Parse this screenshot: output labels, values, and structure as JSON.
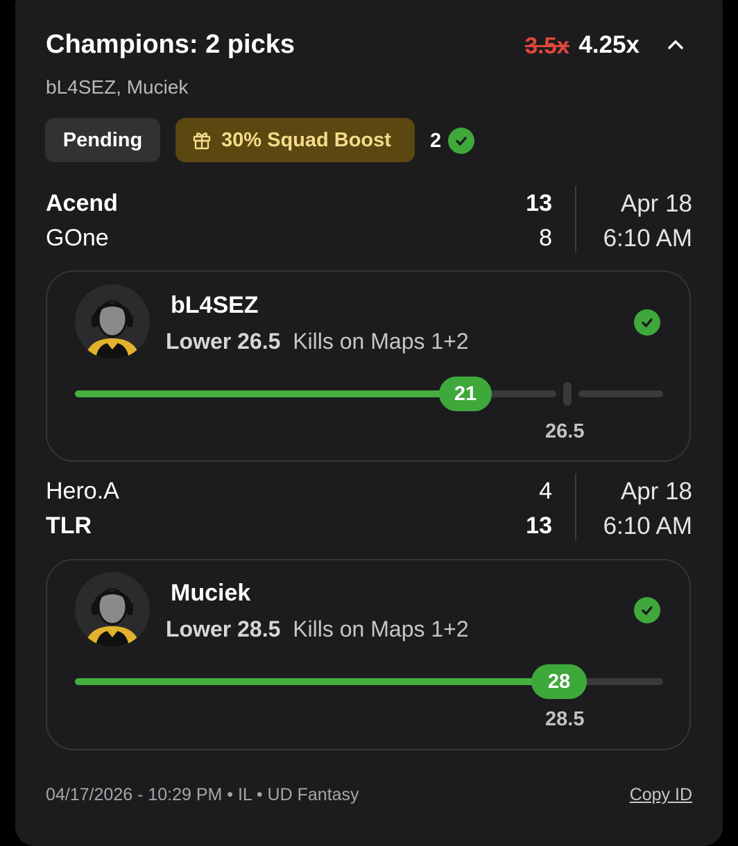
{
  "header": {
    "title": "Champions: 2 picks",
    "old_multiplier": "3.5x",
    "new_multiplier": "4.25x",
    "players": "bL4SEZ, Muciek",
    "collapse_icon": "chevron-up-icon"
  },
  "badges": {
    "status": "Pending",
    "boost_icon": "gift-icon",
    "boost": "30% Squad Boost",
    "won_count": "2"
  },
  "matches": [
    {
      "team1": "Acend",
      "score1": "13",
      "team2": "GOne",
      "score2": "8",
      "date": "Apr 18",
      "time": "6:10 AM",
      "pick": {
        "player": "bL4SEZ",
        "direction": "Lower 26.5",
        "stat": "Kills on Maps 1+2",
        "current": "21",
        "line": "26.5",
        "current_value": 21,
        "line_value": 26.5
      }
    },
    {
      "team1": "Hero.A",
      "score1": "4",
      "team2": "TLR",
      "score2": "13",
      "date": "Apr 18",
      "time": "6:10 AM",
      "pick": {
        "player": "Muciek",
        "direction": "Lower 28.5",
        "stat": "Kills on Maps 1+2",
        "current": "28",
        "line": "28.5",
        "current_value": 28,
        "line_value": 28.5
      }
    }
  ],
  "footer": {
    "meta": "04/17/2026 - 10:29 PM • IL • UD Fantasy",
    "copy_id": "Copy ID"
  },
  "colors": {
    "card_bg": "#1c1c1e",
    "success_green": "#3fa83b",
    "strike_red": "#e0463b",
    "boost_bg": "#5b4710",
    "boost_text": "#f3dc8a"
  }
}
